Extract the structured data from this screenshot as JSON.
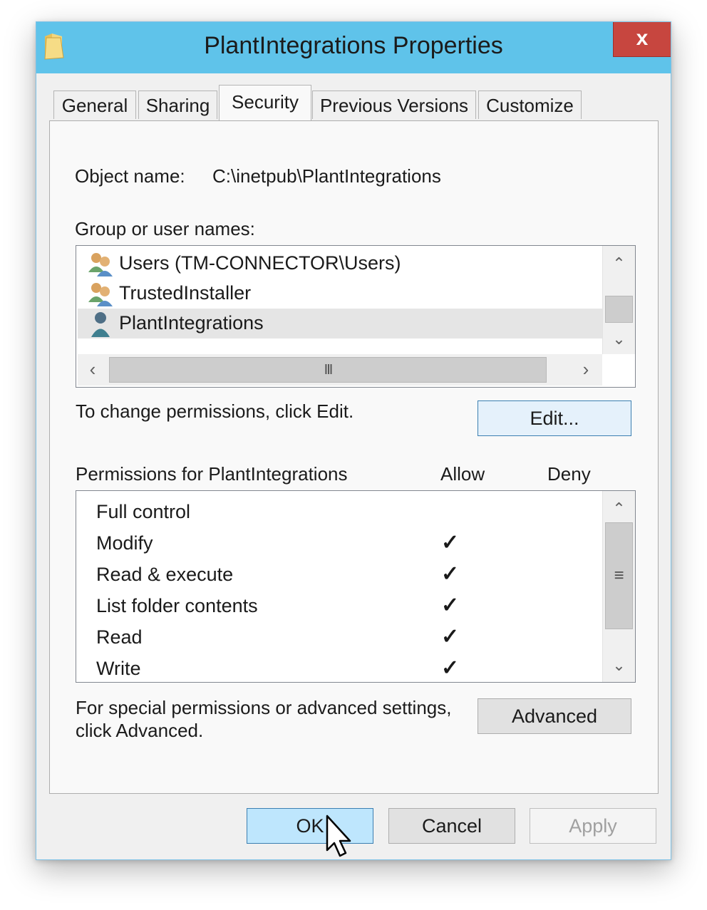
{
  "window": {
    "title": "PlantIntegrations Properties",
    "close_label": "x",
    "accent_color": "#5fc3ea",
    "close_color": "#c7463f"
  },
  "tabs": [
    {
      "label": "General",
      "active": false
    },
    {
      "label": "Sharing",
      "active": false
    },
    {
      "label": "Security",
      "active": true
    },
    {
      "label": "Previous Versions",
      "active": false
    },
    {
      "label": "Customize",
      "active": false
    }
  ],
  "security": {
    "object_name_label": "Object name:",
    "object_name_value": "C:\\inetpub\\PlantIntegrations",
    "group_label": "Group or user names:",
    "users": [
      {
        "name": "Users (TM-CONNECTOR\\Users)",
        "icon": "group-users-icon",
        "selected": false
      },
      {
        "name": "TrustedInstaller",
        "icon": "group-users-icon",
        "selected": false
      },
      {
        "name": "PlantIntegrations",
        "icon": "single-user-icon",
        "selected": true
      }
    ],
    "hscroll_grip": "III",
    "change_hint": "To change permissions, click Edit.",
    "edit_label": "Edit...",
    "permissions_header": "Permissions for PlantIntegrations",
    "allow_header": "Allow",
    "deny_header": "Deny",
    "permissions": [
      {
        "name": "Full control",
        "allow": false,
        "deny": false
      },
      {
        "name": "Modify",
        "allow": true,
        "deny": false
      },
      {
        "name": "Read & execute",
        "allow": true,
        "deny": false
      },
      {
        "name": "List folder contents",
        "allow": true,
        "deny": false
      },
      {
        "name": "Read",
        "allow": true,
        "deny": false
      },
      {
        "name": "Write",
        "allow": true,
        "deny": false
      }
    ],
    "check_glyph": "✓",
    "vscroll_grip": "≡",
    "advanced_hint_line1": "For special permissions or advanced settings,",
    "advanced_hint_line2": "click Advanced.",
    "advanced_label": "Advanced"
  },
  "footer": {
    "ok_label": "OK",
    "cancel_label": "Cancel",
    "apply_label": "Apply"
  }
}
